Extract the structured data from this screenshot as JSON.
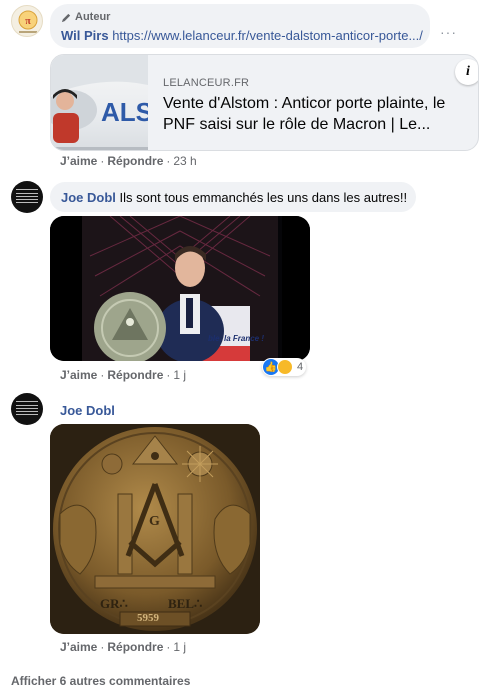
{
  "comment1": {
    "badge": "Auteur",
    "author": "Wil Pirs",
    "text": "https://www.lelanceur.fr/vente-dalstom-anticor-porte.../",
    "preview": {
      "domain": "LELANCEUR.FR",
      "title": "Vente d'Alstom : Anticor porte plainte, le PNF saisi sur le rôle de Macron | Le...",
      "thumb_text": "ALS",
      "info": "i"
    },
    "actions": {
      "like": "J’aime",
      "reply": "Répondre",
      "time": "23 h"
    },
    "more": "···"
  },
  "comment2": {
    "author": "Joe Dobl",
    "text": "Ils sont tous emmanchés les uns dans les autres!!",
    "image_caption": "ble, la France !",
    "reactions": {
      "count": "4"
    },
    "actions": {
      "like": "J’aime",
      "reply": "Répondre",
      "time": "1 j"
    }
  },
  "comment3": {
    "author": "Joe Dobl",
    "coin": {
      "left": "GR∴",
      "right": "BEL∴",
      "year": "5959",
      "letter": "G"
    },
    "actions": {
      "like": "J’aime",
      "reply": "Répondre",
      "time": "1 j"
    }
  },
  "more_comments": "Afficher 6 autres commentaires",
  "colors": {
    "link": "#385898",
    "meta": "#65676b",
    "bubble": "#f0f2f5",
    "like": "#1877f2"
  }
}
